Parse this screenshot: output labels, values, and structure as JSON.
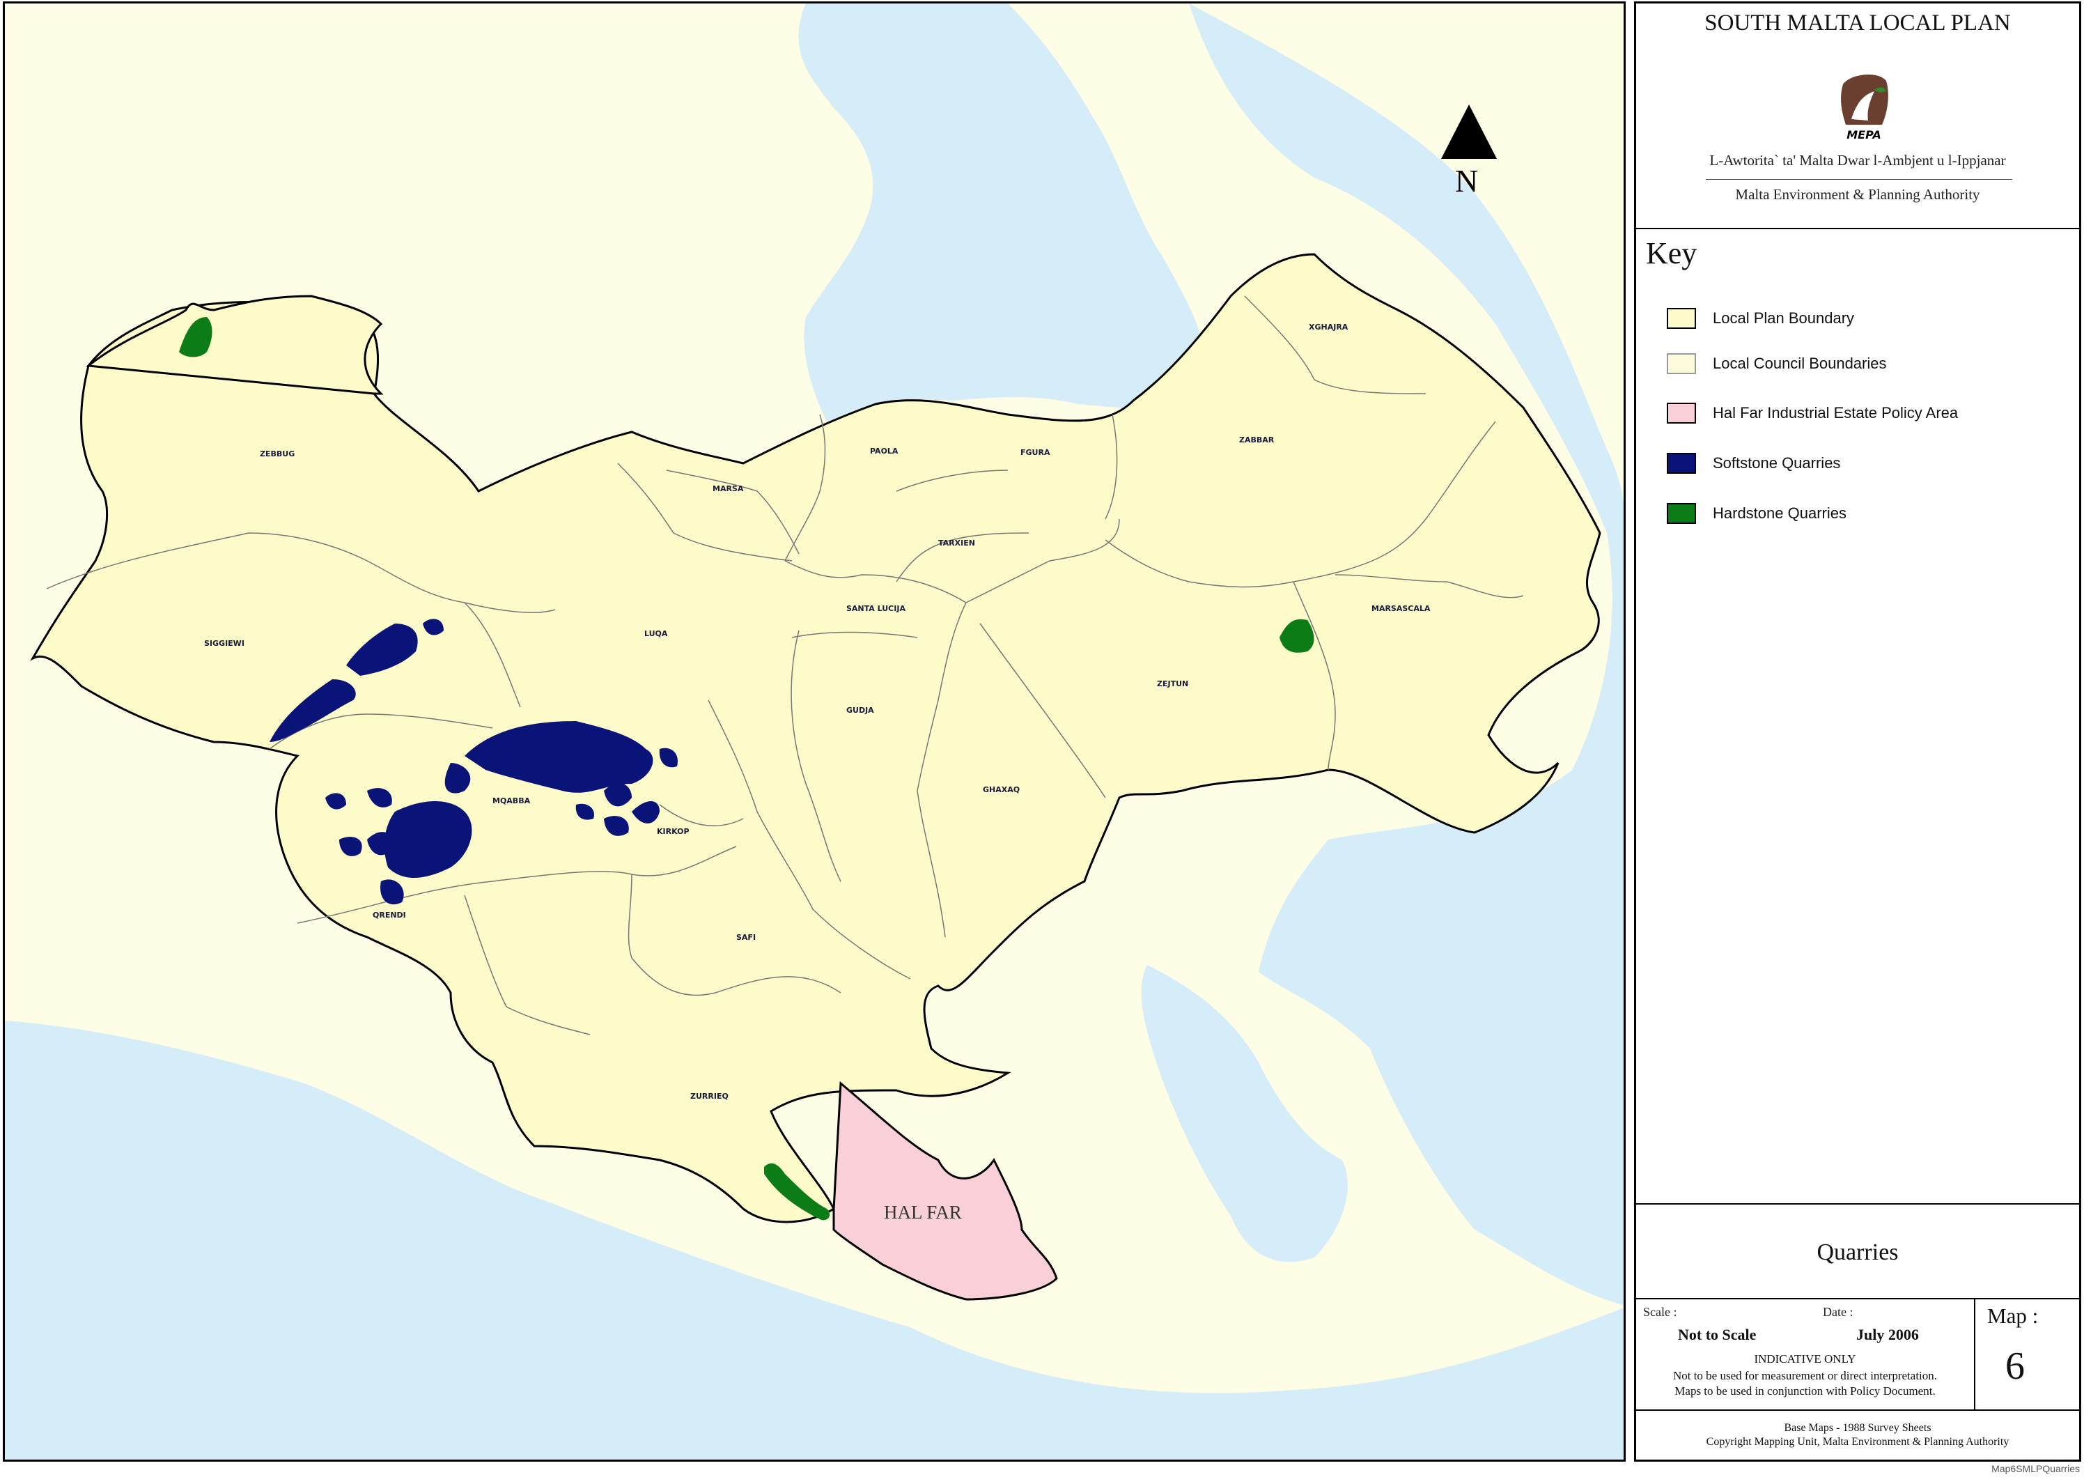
{
  "map": {
    "north_label": "N",
    "hal_far_label": "HAL FAR",
    "places": [
      {
        "name": "ZEBBUG"
      },
      {
        "name": "SIGGIEWI"
      },
      {
        "name": "LUQA"
      },
      {
        "name": "MARSA"
      },
      {
        "name": "PAOLA"
      },
      {
        "name": "FGURA"
      },
      {
        "name": "TARXIEN"
      },
      {
        "name": "SANTA LUCIJA"
      },
      {
        "name": "XGHAJRA"
      },
      {
        "name": "ZABBAR"
      },
      {
        "name": "MARSASCALA"
      },
      {
        "name": "ZEJTUN"
      },
      {
        "name": "GUDJA"
      },
      {
        "name": "GHAXAQ"
      },
      {
        "name": "MQABBA"
      },
      {
        "name": "KIRKOP"
      },
      {
        "name": "QRENDI"
      },
      {
        "name": "SAFI"
      },
      {
        "name": "ZURRIEQ"
      }
    ]
  },
  "panel": {
    "title": "SOUTH MALTA LOCAL PLAN",
    "logo_text": "MEPA",
    "authority_mt": "L-Awtorita` ta' Malta Dwar l-Ambjent u l-Ippjanar",
    "authority_en": "Malta Environment & Planning Authority",
    "key_heading": "Key",
    "key_items": [
      {
        "label": "Local Plan Boundary",
        "color": "#fdfbc9"
      },
      {
        "label": "Local Council Boundaries",
        "color": "#fdfbdc"
      },
      {
        "label": "Hal Far Industrial Estate Policy Area",
        "color": "#f9d0d7"
      },
      {
        "label": "Softstone Quarries",
        "color": "#0a1478"
      },
      {
        "label": "Hardstone Quarries",
        "color": "#0c7d16"
      }
    ],
    "map_subject": "Quarries",
    "scale_label": "Scale :",
    "scale_value": "Not to Scale",
    "date_label": "Date :",
    "date_value": "July 2006",
    "indicative": "INDICATIVE ONLY",
    "note1": "Not to be used for measurement or direct interpretation.",
    "note2": "Maps to be used in conjunction with Policy Document.",
    "map_label": "Map :",
    "map_number": "6",
    "base_maps": "Base Maps - 1988 Survey Sheets",
    "copyright": "Copyright Mapping Unit, Malta Environment & Planning Authority"
  },
  "file_ref": "Map6SMLPQuarries",
  "colors": {
    "sea": "#d4edf9",
    "plan_area": "#fdfbc9",
    "outside_land": "#fefde6",
    "hal_far": "#f9d0d7",
    "softstone": "#0a1478",
    "hardstone": "#0c7d16"
  }
}
